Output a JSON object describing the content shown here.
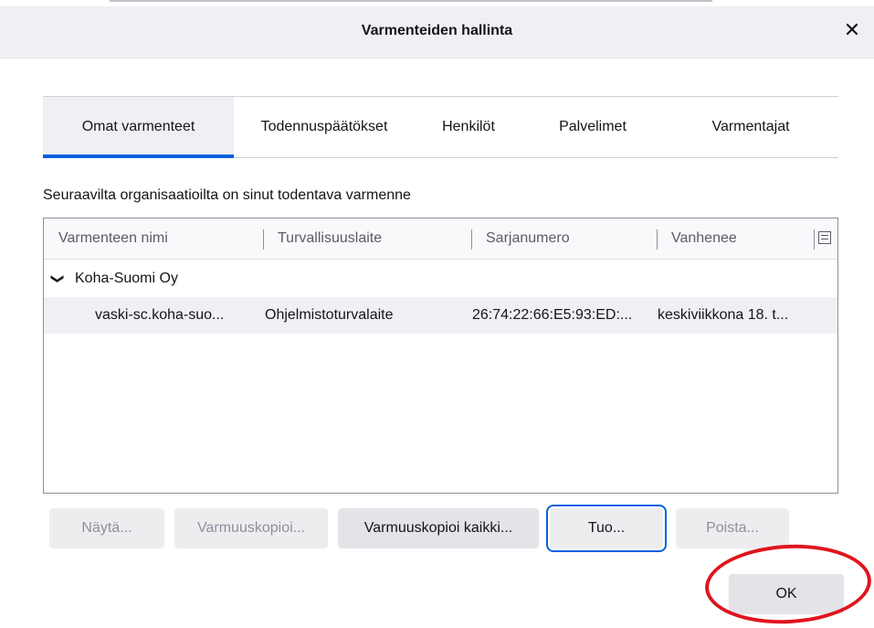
{
  "dialog": {
    "title": "Varmenteiden hallinta",
    "close_symbol": "✕"
  },
  "tabs": [
    {
      "label": "Omat varmenteet",
      "selected": true
    },
    {
      "label": "Todennuspäätökset",
      "selected": false
    },
    {
      "label": "Henkilöt",
      "selected": false
    },
    {
      "label": "Palvelimet",
      "selected": false
    },
    {
      "label": "Varmentajat",
      "selected": false
    }
  ],
  "description": "Seuraavilta organisaatioilta on sinut todentava varmenne",
  "table": {
    "columns": [
      "Varmenteen nimi",
      "Turvallisuuslaite",
      "Sarjanumero",
      "Vanhenee"
    ],
    "column_picker_icon": "column-picker-icon",
    "groups": [
      {
        "name": "Koha-Suomi Oy",
        "expanded": true,
        "rows": [
          {
            "name": "vaski-sc.koha-suo...",
            "device": "Ohjelmistoturvalaite",
            "serial": "26:74:22:66:E5:93:ED:...",
            "expires": "keskiviikkona 18. t..."
          }
        ]
      }
    ]
  },
  "buttons": {
    "view": "Näytä...",
    "backup": "Varmuuskopioi...",
    "backup_all": "Varmuuskopioi kaikki...",
    "import": "Tuo...",
    "delete": "Poista...",
    "ok": "OK"
  },
  "colors": {
    "accent": "#0061e0",
    "annotation": "#e0141d"
  }
}
